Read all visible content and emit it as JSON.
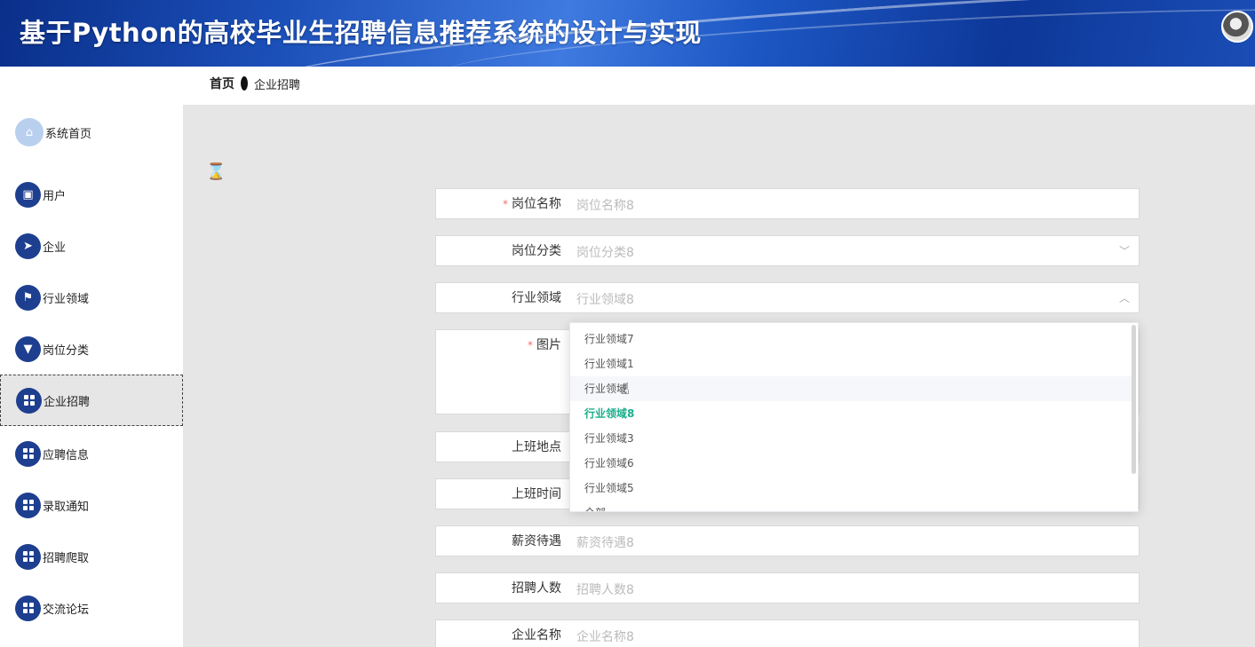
{
  "header": {
    "title": "基于Python的高校毕业生招聘信息推荐系统的设计与实现"
  },
  "breadcrumb": {
    "home": "首页",
    "current": "企业招聘"
  },
  "sidebar": {
    "items": [
      {
        "label": "系统首页",
        "icon": "home-icon"
      },
      {
        "label": "用户",
        "icon": "clipboard-icon"
      },
      {
        "label": "企业",
        "icon": "paper-plane-icon"
      },
      {
        "label": "行业领域",
        "icon": "flag-icon"
      },
      {
        "label": "岗位分类",
        "icon": "pin-icon"
      },
      {
        "label": "企业招聘",
        "icon": "grid-icon",
        "active": true
      },
      {
        "label": "应聘信息",
        "icon": "grid-icon"
      },
      {
        "label": "录取通知",
        "icon": "grid-icon"
      },
      {
        "label": "招聘爬取",
        "icon": "grid-icon"
      },
      {
        "label": "交流论坛",
        "icon": "grid-icon"
      }
    ]
  },
  "form": {
    "job_name": {
      "label": "岗位名称",
      "placeholder": "岗位名称8",
      "required": true
    },
    "job_category": {
      "label": "岗位分类",
      "placeholder": "岗位分类8"
    },
    "industry": {
      "label": "行业领域",
      "placeholder": "行业领域8"
    },
    "image": {
      "label": "图片",
      "required": true
    },
    "work_location": {
      "label": "上班地点"
    },
    "work_time": {
      "label": "上班时间"
    },
    "salary": {
      "label": "薪资待遇",
      "placeholder": "薪资待遇8"
    },
    "headcount": {
      "label": "招聘人数",
      "placeholder": "招聘人数8"
    },
    "company_name": {
      "label": "企业名称",
      "placeholder": "企业名称8"
    }
  },
  "dropdown": {
    "options": [
      "行业领域7",
      "行业领域1",
      "行业领域",
      "行业领域8",
      "行业领域3",
      "行业领域6",
      "行业领域5"
    ],
    "selected": "行业领域8",
    "hovered": "行业领域",
    "partial_option": "全部"
  },
  "colors": {
    "sidebar_icon": "#1e3f8f",
    "selected_option": "#1aaf8b",
    "required_mark": "#f56c6c"
  }
}
